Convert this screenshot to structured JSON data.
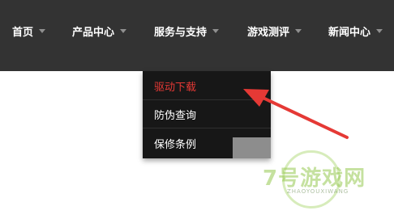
{
  "nav": {
    "items": [
      {
        "label": "首页"
      },
      {
        "label": "产品中心"
      },
      {
        "label": "服务与支持"
      },
      {
        "label": "游戏测评"
      },
      {
        "label": "新闻中心"
      }
    ]
  },
  "dropdown": {
    "items": [
      {
        "label": "驱动下载",
        "state": "hover"
      },
      {
        "label": "防伪查询"
      },
      {
        "label": "保修条例"
      }
    ]
  },
  "watermark": {
    "brand": "7号游戏网",
    "sub": "ZHAOYOUXIWANG"
  },
  "colors": {
    "topbar": "#333333",
    "dropdown_bg": "#171717",
    "highlight": "#e53935",
    "arrow": "#e53935"
  }
}
